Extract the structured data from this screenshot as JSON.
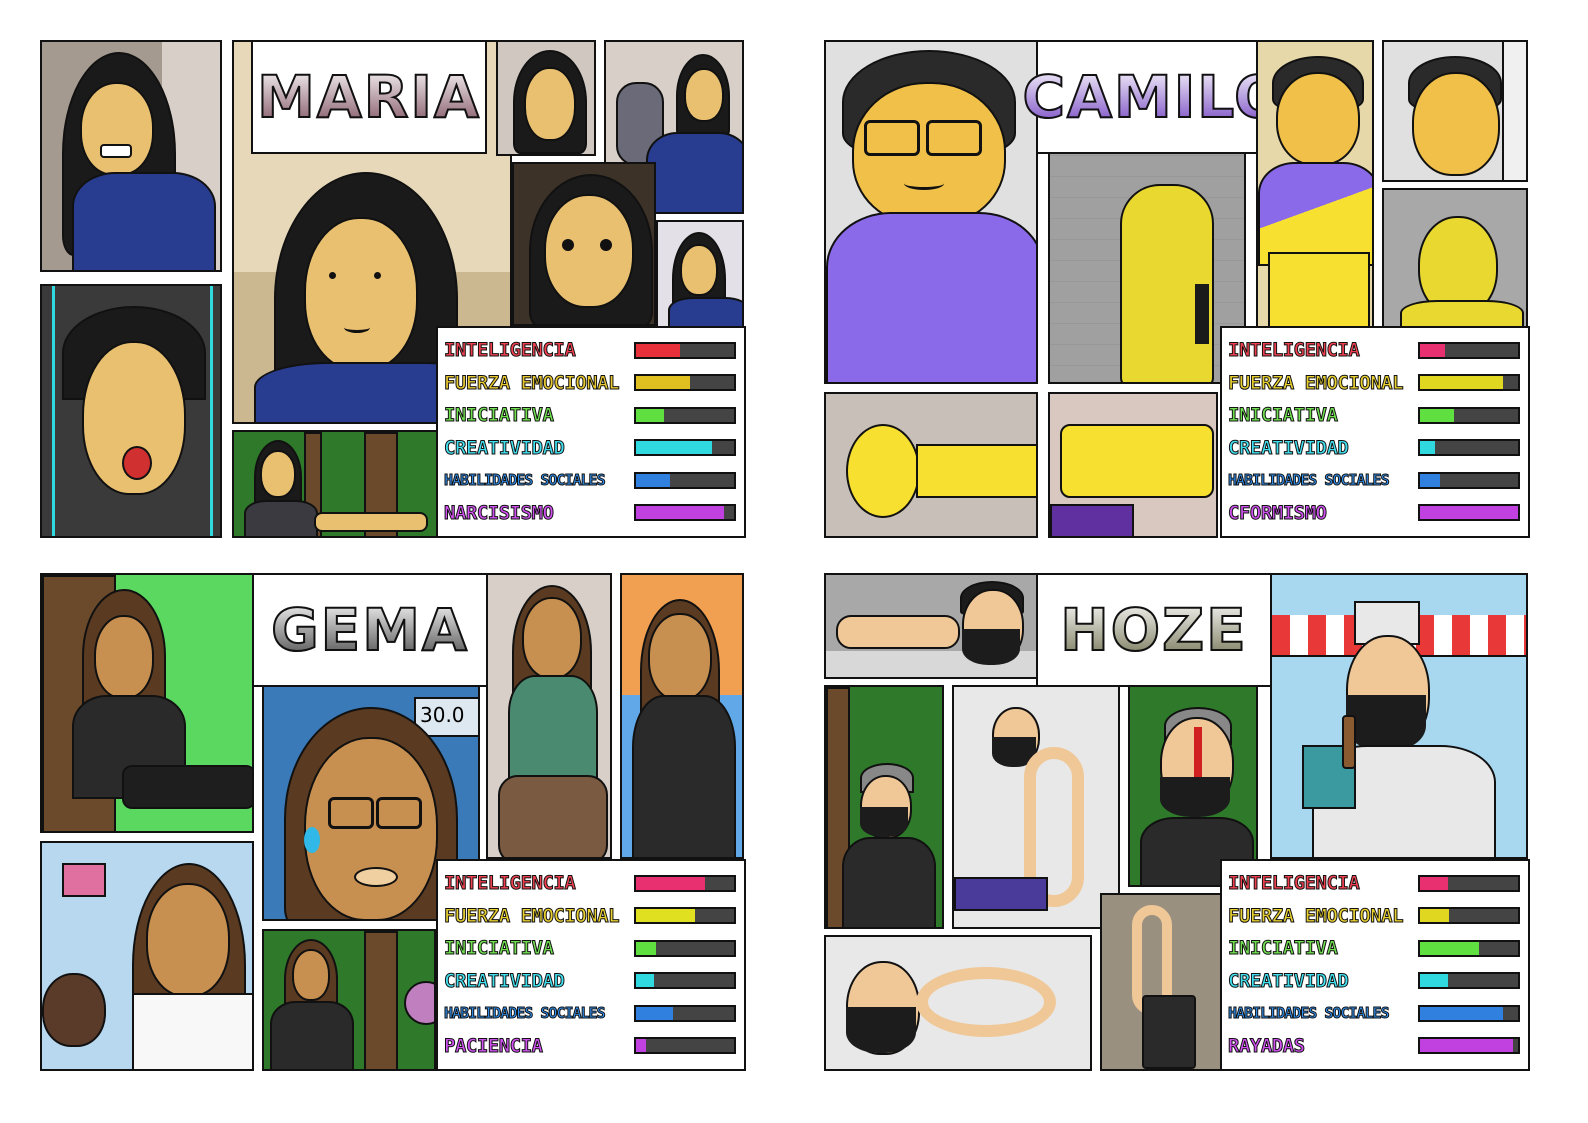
{
  "cards": [
    {
      "name": "MARIA",
      "name_gradient": [
        "#ffffff",
        "#7a4a5a"
      ],
      "stats": [
        {
          "label": "INTELIGENCIA",
          "value": 0.45,
          "color": "#e8303a",
          "text_color": "#f04050"
        },
        {
          "label": "FUERZA EMOCIONAL",
          "value": 0.55,
          "color": "#e0c020",
          "text_color": "#e8c830"
        },
        {
          "label": "INICIATIVA",
          "value": 0.28,
          "color": "#60e040",
          "text_color": "#70e050"
        },
        {
          "label": "CREATIVIDAD",
          "value": 0.78,
          "color": "#30d8e0",
          "text_color": "#40e0f0"
        },
        {
          "label": "HABILIDADES SOCIALES",
          "value": 0.35,
          "color": "#3080e0",
          "text_color": "#3090f0"
        },
        {
          "label": "NARCISISMO",
          "value": 0.9,
          "color": "#c040e0",
          "text_color": "#d050f0"
        }
      ]
    },
    {
      "name": "CAMILO",
      "name_gradient": [
        "#ffffff",
        "#7040c0"
      ],
      "stats": [
        {
          "label": "INTELIGENCIA",
          "value": 0.25,
          "color": "#e83070",
          "text_color": "#f04050"
        },
        {
          "label": "FUERZA EMOCIONAL",
          "value": 0.85,
          "color": "#e0d820",
          "text_color": "#e8d030"
        },
        {
          "label": "INICIATIVA",
          "value": 0.35,
          "color": "#60e040",
          "text_color": "#70e050"
        },
        {
          "label": "CREATIVIDAD",
          "value": 0.15,
          "color": "#30d8e0",
          "text_color": "#40e0f0"
        },
        {
          "label": "HABILIDADES SOCIALES",
          "value": 0.2,
          "color": "#3080e0",
          "text_color": "#3090f0"
        },
        {
          "label": "CFORMISMO",
          "value": 1.0,
          "color": "#c040e0",
          "text_color": "#d050f0"
        }
      ]
    },
    {
      "name": "GEMA",
      "name_gradient": [
        "#ffffff",
        "#444444"
      ],
      "stats": [
        {
          "label": "INTELIGENCIA",
          "value": 0.7,
          "color": "#e83070",
          "text_color": "#f04050"
        },
        {
          "label": "FUERZA EMOCIONAL",
          "value": 0.6,
          "color": "#e0e020",
          "text_color": "#e8d030"
        },
        {
          "label": "INICIATIVA",
          "value": 0.2,
          "color": "#60e040",
          "text_color": "#70e050"
        },
        {
          "label": "CREATIVIDAD",
          "value": 0.18,
          "color": "#30d8e0",
          "text_color": "#40e0f0"
        },
        {
          "label": "HABILIDADES SOCIALES",
          "value": 0.38,
          "color": "#3080e0",
          "text_color": "#3090f0"
        },
        {
          "label": "PACIENCIA",
          "value": 0.1,
          "color": "#c040e0",
          "text_color": "#d050f0"
        }
      ]
    },
    {
      "name": "HOZE",
      "name_gradient": [
        "#ffffff",
        "#707050"
      ],
      "stats": [
        {
          "label": "INTELIGENCIA",
          "value": 0.28,
          "color": "#e83070",
          "text_color": "#f04050"
        },
        {
          "label": "FUERZA EMOCIONAL",
          "value": 0.3,
          "color": "#e0d820",
          "text_color": "#e8d030"
        },
        {
          "label": "INICIATIVA",
          "value": 0.6,
          "color": "#60e040",
          "text_color": "#70e050"
        },
        {
          "label": "CREATIVIDAD",
          "value": 0.28,
          "color": "#30d8e0",
          "text_color": "#40e0f0"
        },
        {
          "label": "HABILIDADES SOCIALES",
          "value": 0.85,
          "color": "#3080e0",
          "text_color": "#3090f0"
        },
        {
          "label": "RAYADAS",
          "value": 0.95,
          "color": "#c040e0",
          "text_color": "#d050f0"
        }
      ]
    }
  ],
  "props": {
    "gema_sign_text": "30.0"
  }
}
